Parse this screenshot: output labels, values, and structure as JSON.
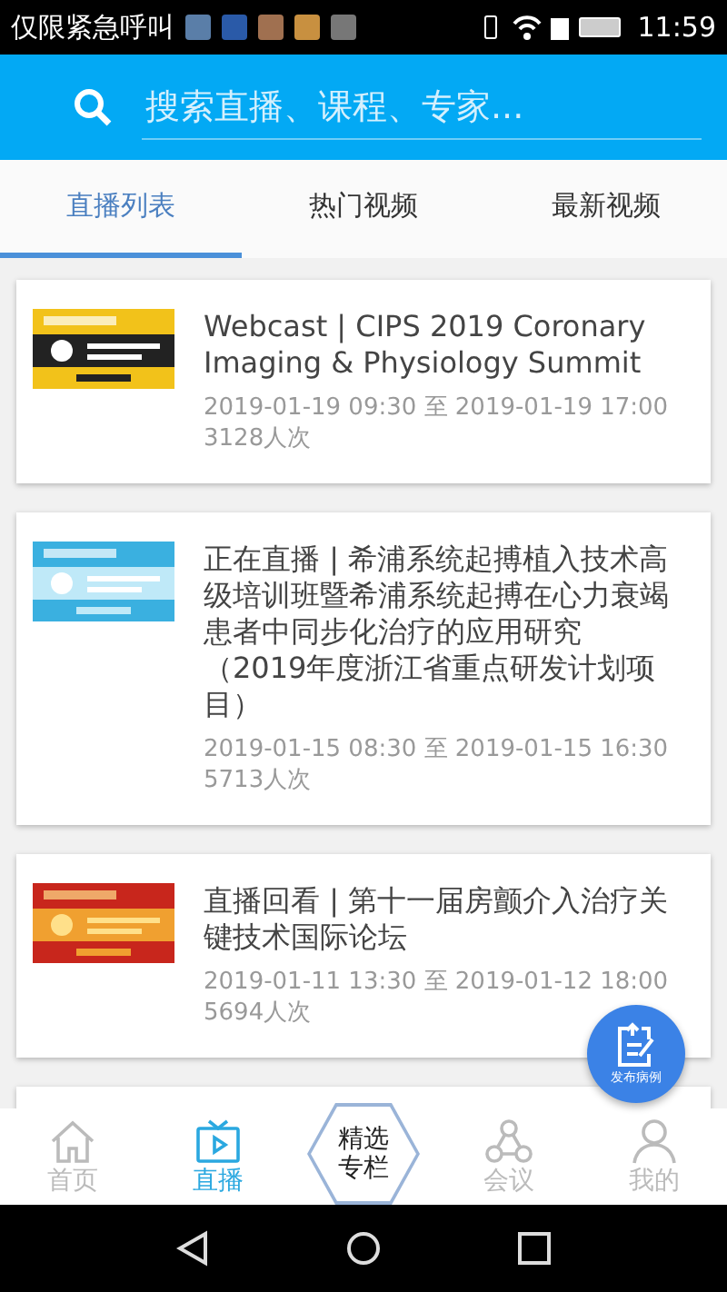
{
  "status_bar": {
    "carrier": "仅限紧急呼叫",
    "time": "11:59"
  },
  "search": {
    "placeholder": "搜索直播、课程、专家..."
  },
  "tabs": [
    {
      "label": "直播列表",
      "selected": true
    },
    {
      "label": "热门视频",
      "selected": false
    },
    {
      "label": "最新视频",
      "selected": false
    }
  ],
  "cards": [
    {
      "title": "Webcast | CIPS 2019 Coronary Imaging & Physiology Summit",
      "time": "2019-01-19 09:30 至 2019-01-19 17:00",
      "views": "3128人次"
    },
    {
      "title": "正在直播 | 希浦系统起搏植入技术高级培训班暨希浦系统起搏在心力衰竭患者中同步化治疗的应用研究（2019年度浙江省重点研发计划项目）",
      "time": "2019-01-15 08:30 至 2019-01-15 16:30",
      "views": "5713人次"
    },
    {
      "title": "直播回看 | 第十一届房颤介入治疗关键技术国际论坛",
      "time": "2019-01-11 13:30 至 2019-01-12 18:00",
      "views": "5694人次"
    }
  ],
  "fab": {
    "label": "发布病例"
  },
  "bottom_nav": [
    {
      "kind": "home",
      "label": "首页",
      "selected": false
    },
    {
      "kind": "tv",
      "label": "直播",
      "selected": true
    },
    {
      "kind": "featured",
      "label": "精选专栏",
      "selected": false
    },
    {
      "kind": "meeting",
      "label": "会议",
      "selected": false
    },
    {
      "kind": "user",
      "label": "我的",
      "selected": false
    }
  ]
}
